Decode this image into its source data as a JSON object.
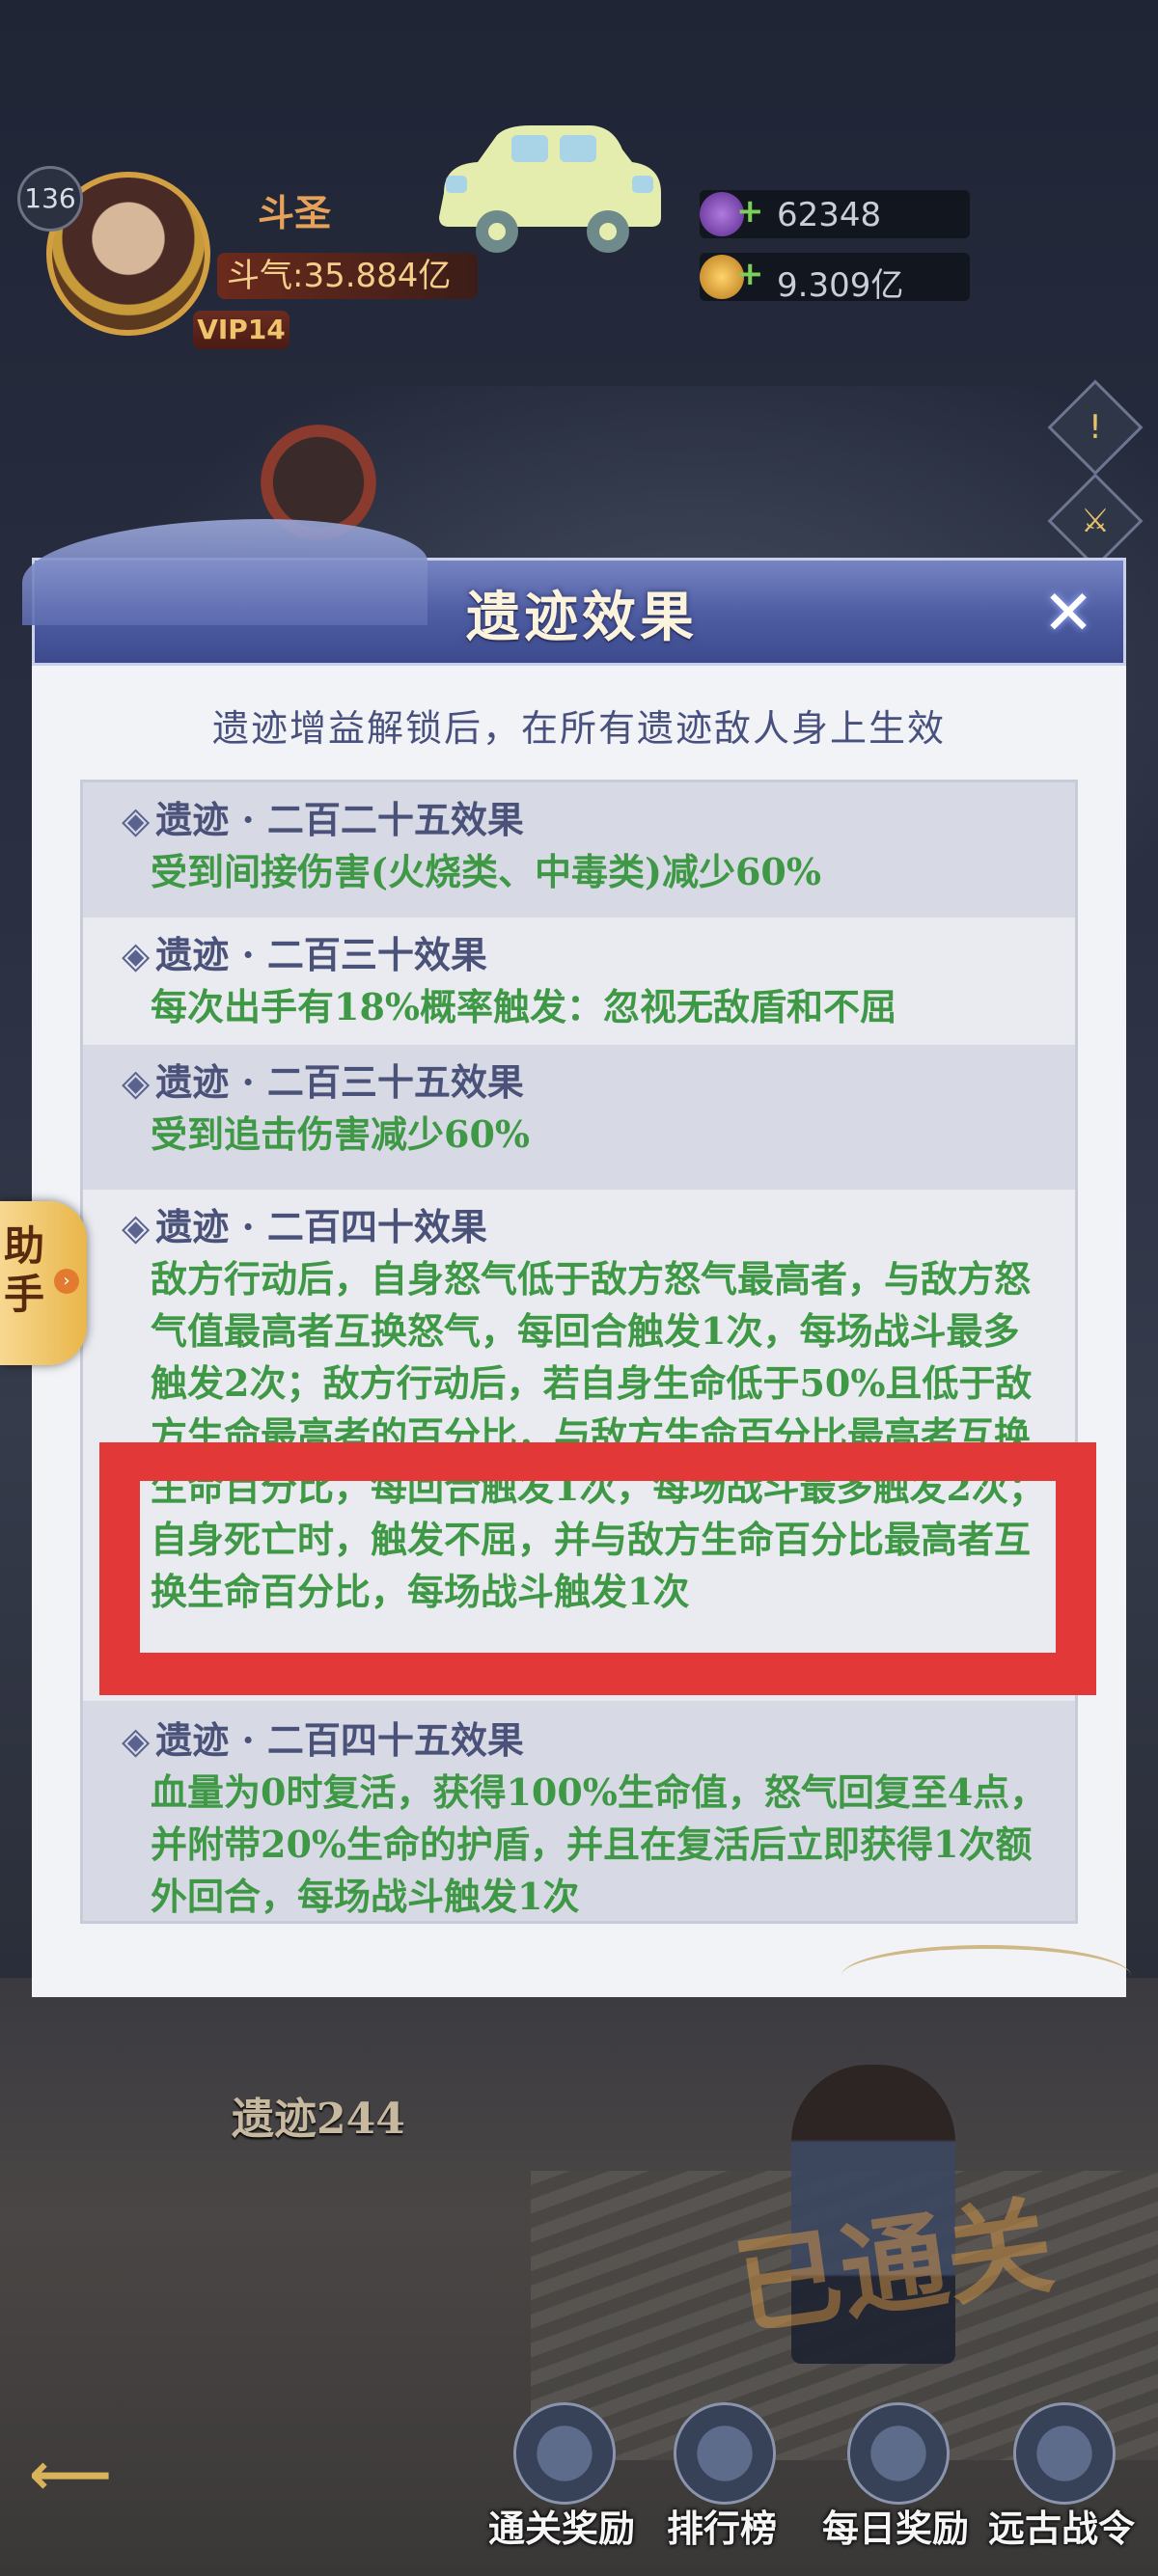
{
  "hud": {
    "level": "136",
    "title": "斗圣",
    "power": "斗气:35.884亿",
    "vip": "VIP14",
    "resources": [
      {
        "icon": "crystal-icon",
        "value": "62348"
      },
      {
        "icon": "gold-coin-icon",
        "value": "9.309亿"
      }
    ],
    "side_buttons": [
      "!",
      "⚔"
    ]
  },
  "helper": {
    "label": "助手",
    "arrow": "›"
  },
  "modal": {
    "title": "遗迹效果",
    "close": "✕",
    "subtitle": "遗迹增益解锁后，在所有遗迹敌人身上生效",
    "entries": [
      {
        "title": "遗迹 · 二百二十五效果",
        "desc": "受到间接伤害(火烧类、中毒类)减少60%"
      },
      {
        "title": "遗迹 · 二百三十效果",
        "desc": "每次出手有18%概率触发：忽视无敌盾和不屈"
      },
      {
        "title": "遗迹 · 二百三十五效果",
        "desc": "受到追击伤害减少60%"
      },
      {
        "title": "遗迹 · 二百四十效果",
        "desc": "敌方行动后，自身怒气低于敌方怒气最高者，与敌方怒气值最高者互换怒气，每回合触发1次，每场战斗最多触发2次；敌方行动后，若自身生命低于50%且低于敌方生命最高者的百分比，与敌方生命百分比最高者互换生命百分比，每回合触发1次，每场战斗最多触发2次；自身死亡时，触发不屈，并与敌方生命百分比最高者互换生命百分比，每场战斗触发1次"
      },
      {
        "title": "遗迹 · 二百四十五效果",
        "desc": "血量为0时复活，获得100%生命值，怒气回复至4点，并附带20%生命的护盾，并且在复活后立即获得1次额外回合，每场战斗触发1次"
      }
    ]
  },
  "stage": {
    "ruin_label": "遗迹244",
    "status": "已通关"
  },
  "bottom_nav": [
    {
      "label": "通关奖励",
      "icon": "reward-bag-icon"
    },
    {
      "label": "排行榜",
      "icon": "ranking-icon"
    },
    {
      "label": "每日奖励",
      "icon": "daily-reward-icon"
    },
    {
      "label": "远古战令",
      "icon": "ancient-pass-icon"
    }
  ],
  "colors": {
    "accent_green": "#3f9845",
    "highlight_red": "#e23838",
    "modal_header": "#4f5ea4"
  }
}
